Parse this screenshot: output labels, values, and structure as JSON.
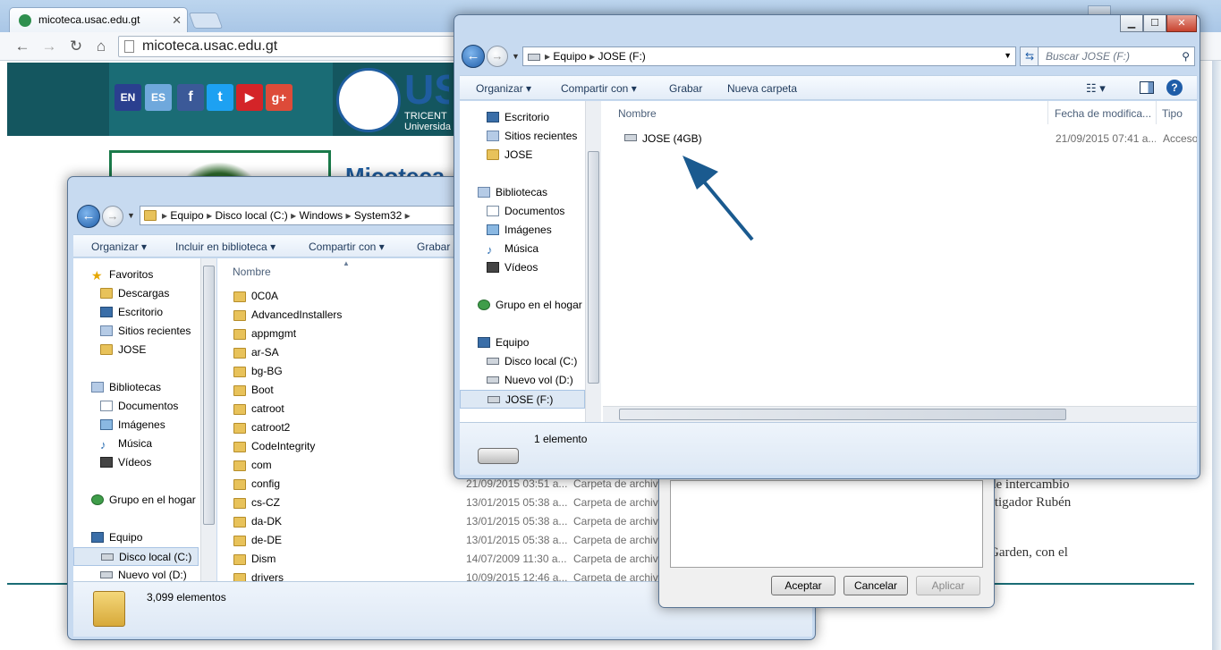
{
  "browser": {
    "tab_title": "micoteca.usac.edu.gt",
    "address": "micoteca.usac.edu.gt"
  },
  "site": {
    "flags": [
      "EN",
      "ES"
    ],
    "social_glyphs": [
      "f",
      "t",
      "▶",
      "g+"
    ],
    "logo_text": "US",
    "logo_sub1": "TRICENT",
    "logo_sub2": "Universida",
    "heading_partial": "Micoteca",
    "text_line1": "de intercambio",
    "text_line2": "stigador Rubén",
    "text_line3": "Garden, con el",
    "colors": {
      "band": "#14565f",
      "accent": "#1a6c75"
    }
  },
  "explorer_back": {
    "breadcrumb": [
      "Equipo",
      "Disco local (C:)",
      "Windows",
      "System32"
    ],
    "commands": [
      "Organizar",
      "Incluir en biblioteca",
      "Compartir con",
      "Grabar"
    ],
    "nav": [
      {
        "label": "Favoritos",
        "icon": "star-icon",
        "level": 0
      },
      {
        "label": "Descargas",
        "icon": "folder-icon",
        "level": 1
      },
      {
        "label": "Escritorio",
        "icon": "desktop-icon",
        "level": 1
      },
      {
        "label": "Sitios recientes",
        "icon": "recent-icon",
        "level": 1
      },
      {
        "label": "JOSE",
        "icon": "folder-icon",
        "level": 1
      },
      {
        "label": "",
        "icon": "",
        "level": 0
      },
      {
        "label": "Bibliotecas",
        "icon": "library-icon",
        "level": 0
      },
      {
        "label": "Documentos",
        "icon": "documents-icon",
        "level": 1
      },
      {
        "label": "Imágenes",
        "icon": "pictures-icon",
        "level": 1
      },
      {
        "label": "Música",
        "icon": "music-icon",
        "level": 1
      },
      {
        "label": "Vídeos",
        "icon": "videos-icon",
        "level": 1
      },
      {
        "label": "",
        "icon": "",
        "level": 0
      },
      {
        "label": "Grupo en el hogar",
        "icon": "homegroup-icon",
        "level": 0
      },
      {
        "label": "",
        "icon": "",
        "level": 0
      },
      {
        "label": "Equipo",
        "icon": "computer-icon",
        "level": 0
      },
      {
        "label": "Disco local (C:)",
        "icon": "drive-icon",
        "level": 1,
        "selected": true
      },
      {
        "label": "Nuevo vol (D:)",
        "icon": "drive-icon",
        "level": 1
      }
    ],
    "column_name": "Nombre",
    "files": [
      {
        "name": "0C0A",
        "date": "",
        "type": ""
      },
      {
        "name": "AdvancedInstallers",
        "date": "",
        "type": ""
      },
      {
        "name": "appmgmt",
        "date": "",
        "type": ""
      },
      {
        "name": "ar-SA",
        "date": "",
        "type": ""
      },
      {
        "name": "bg-BG",
        "date": "",
        "type": ""
      },
      {
        "name": "Boot",
        "date": "",
        "type": ""
      },
      {
        "name": "catroot",
        "date": "",
        "type": ""
      },
      {
        "name": "catroot2",
        "date": "",
        "type": ""
      },
      {
        "name": "CodeIntegrity",
        "date": "",
        "type": ""
      },
      {
        "name": "com",
        "date": "",
        "type": ""
      },
      {
        "name": "config",
        "date": "21/09/2015 03:51 a...",
        "type": "Carpeta de archivo"
      },
      {
        "name": "cs-CZ",
        "date": "13/01/2015 05:38 a...",
        "type": "Carpeta de archivo"
      },
      {
        "name": "da-DK",
        "date": "13/01/2015 05:38 a...",
        "type": "Carpeta de archivo"
      },
      {
        "name": "de-DE",
        "date": "13/01/2015 05:38 a...",
        "type": "Carpeta de archivo"
      },
      {
        "name": "Dism",
        "date": "14/07/2009 11:30 a...",
        "type": "Carpeta de archivo"
      },
      {
        "name": "drivers",
        "date": "10/09/2015 12:46 a...",
        "type": "Carpeta de archivo"
      }
    ],
    "status": "3,099 elementos"
  },
  "dialog": {
    "ok": "Aceptar",
    "cancel": "Cancelar",
    "apply": "Aplicar"
  },
  "explorer_front": {
    "breadcrumb": [
      "Equipo",
      "JOSE (F:)"
    ],
    "search_placeholder": "Buscar JOSE (F:)",
    "commands": [
      "Organizar",
      "Compartir con",
      "Grabar",
      "Nueva carpeta"
    ],
    "nav": [
      {
        "label": "Escritorio",
        "icon": "desktop-icon",
        "level": 1
      },
      {
        "label": "Sitios recientes",
        "icon": "recent-icon",
        "level": 1
      },
      {
        "label": "JOSE",
        "icon": "folder-icon",
        "level": 1
      },
      {
        "label": "",
        "icon": "",
        "level": 0
      },
      {
        "label": "Bibliotecas",
        "icon": "library-icon",
        "level": 0
      },
      {
        "label": "Documentos",
        "icon": "documents-icon",
        "level": 1
      },
      {
        "label": "Imágenes",
        "icon": "pictures-icon",
        "level": 1
      },
      {
        "label": "Música",
        "icon": "music-icon",
        "level": 1
      },
      {
        "label": "Vídeos",
        "icon": "videos-icon",
        "level": 1
      },
      {
        "label": "",
        "icon": "",
        "level": 0
      },
      {
        "label": "Grupo en el hogar",
        "icon": "homegroup-icon",
        "level": 0
      },
      {
        "label": "",
        "icon": "",
        "level": 0
      },
      {
        "label": "Equipo",
        "icon": "computer-icon",
        "level": 0
      },
      {
        "label": "Disco local (C:)",
        "icon": "drive-icon",
        "level": 1
      },
      {
        "label": "Nuevo vol (D:)",
        "icon": "drive-icon",
        "level": 1
      },
      {
        "label": "JOSE (F:)",
        "icon": "drive-icon",
        "level": 1,
        "selected": true
      }
    ],
    "columns": [
      "Nombre",
      "Fecha de modifica...",
      "Tipo"
    ],
    "files": [
      {
        "name": "JOSE (4GB)",
        "date": "21/09/2015 07:41 a...",
        "type": "Acceso"
      }
    ],
    "status": "1 elemento"
  }
}
